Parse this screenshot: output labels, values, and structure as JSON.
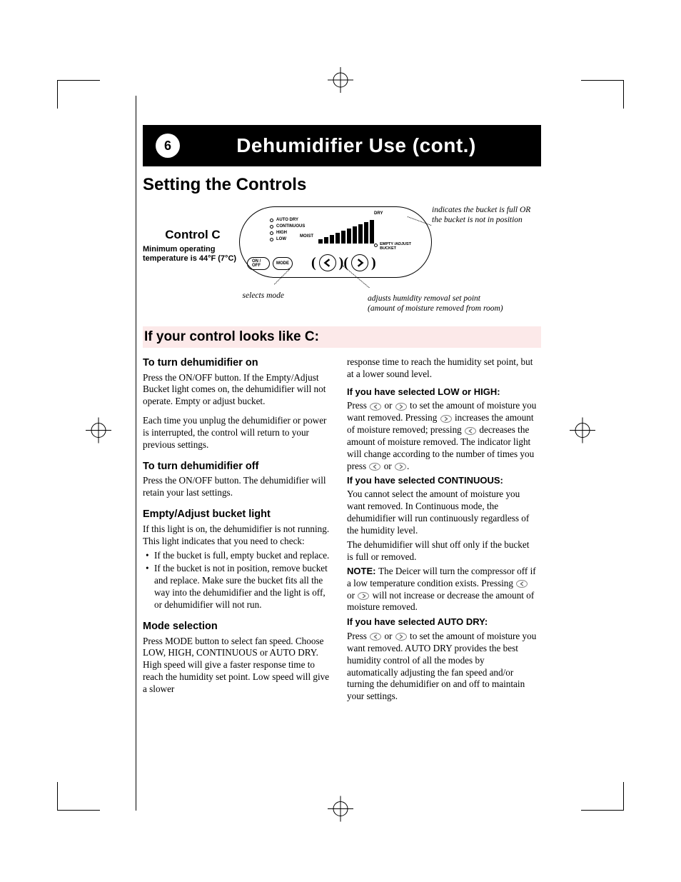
{
  "header": {
    "page_number": "6",
    "title": "Dehumidifier Use (cont.)"
  },
  "section_title": "Setting the Controls",
  "control": {
    "name": "Control C",
    "min_temp": "Minimum operating temperature is 44°F (7°C)",
    "leds": [
      "AUTO DRY",
      "CONTINUOUS",
      "HIGH",
      "LOW"
    ],
    "btn_onoff": "ON / OFF",
    "btn_mode": "MODE",
    "label_dry": "DRY",
    "label_moist": "MOIST",
    "empty_label": "EMPTY /ADJUST BUCKET"
  },
  "callouts": {
    "bucket": "indicates the bucket is full OR\nthe bucket is not in position",
    "adjust": "adjusts humidity removal set point\n(amount of moisture removed from room)",
    "mode": "selects mode"
  },
  "subheader": "If your control looks like C:",
  "left": {
    "h1": "To turn dehumidifier on",
    "p1": "Press the ON/OFF button. If the Empty/Adjust Bucket light comes on, the dehumidifier will not operate. Empty or adjust bucket.",
    "p2": "Each time you unplug the dehumidifier or power is interrupted, the control will return to your previous settings.",
    "h2": "To turn dehumidifier off",
    "p3": "Press the ON/OFF button. The dehumidifier will retain your last settings.",
    "h3": "Empty/Adjust bucket light",
    "p4": "If this light is on, the dehumidifier is not running. This light indicates that you need to check:",
    "li1": "If the bucket is full, empty bucket and replace.",
    "li2": "If the bucket is not in position, remove bucket and replace. Make sure the bucket fits all the way into the dehumidifier and the light is off, or dehumidifier will not run.",
    "h4": "Mode selection",
    "p5": "Press MODE button to select fan speed. Choose LOW, HIGH, CONTINUOUS or AUTO DRY. High speed will give a faster response time to reach the humidity set point. Low speed will give a slower"
  },
  "right": {
    "p0": "response time to reach the humidity set point, but at a lower sound level.",
    "b1": "If you have selected LOW or HIGH:",
    "p1a": "Press ",
    "p1b": " or ",
    "p1c": " to set the amount of moisture you want removed. Pressing ",
    "p1d": " increases the amount of moisture removed; pressing ",
    "p1e": " decreases the amount of moisture removed. The indicator light will change according to the number of times you press ",
    "p1f": " or ",
    "p1g": ".",
    "b2": "If you have selected CONTINUOUS:",
    "p2": "You cannot select the amount of moisture you want removed. In Continuous mode, the dehumidifier will run continuously regardless of the humidity level.",
    "p3": "The dehumidifier will shut off only if the bucket is full or removed.",
    "p4a": "NOTE: ",
    "p4b": "The Deicer will turn the compressor off if a low temperature condition exists. Pressing ",
    "p4c": " or ",
    "p4d": " will not increase or decrease the amount of moisture removed.",
    "b3": "If you have selected AUTO DRY:",
    "p5a": "Press ",
    "p5b": " or ",
    "p5c": " to set the amount of moisture you want removed. AUTO DRY provides the best humidity control of all the modes by automatically adjusting the fan speed and/or turning the dehumidifier on and off to maintain your settings."
  }
}
